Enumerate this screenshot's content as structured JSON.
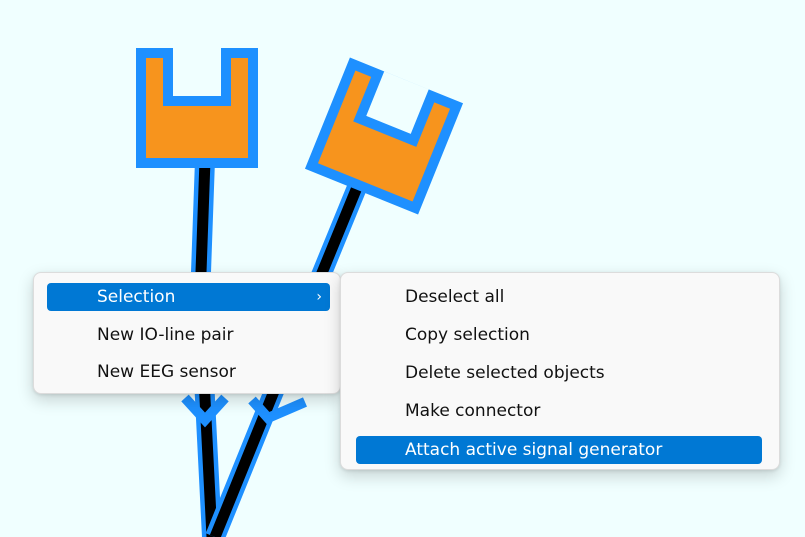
{
  "canvas": {
    "background": "#f0ffff",
    "sensor_fill": "#f7941d",
    "sensor_outline": "#1e90ff",
    "wire_color": "#000000"
  },
  "context_menu": {
    "items": [
      {
        "label": "Selection",
        "has_submenu": true,
        "submenu_icon": "chevron-right-icon",
        "highlighted": true
      },
      {
        "label": "New IO-line pair",
        "highlighted": false
      },
      {
        "label": "New EEG sensor",
        "highlighted": false
      }
    ]
  },
  "submenu": {
    "items": [
      {
        "label": "Deselect all",
        "highlighted": false
      },
      {
        "label": "Copy selection",
        "highlighted": false
      },
      {
        "label": "Delete selected objects",
        "highlighted": false
      },
      {
        "label": "Make connector",
        "highlighted": false
      },
      {
        "label": "Attach active signal generator",
        "highlighted": true
      }
    ]
  },
  "accent_color": "#0078d4"
}
